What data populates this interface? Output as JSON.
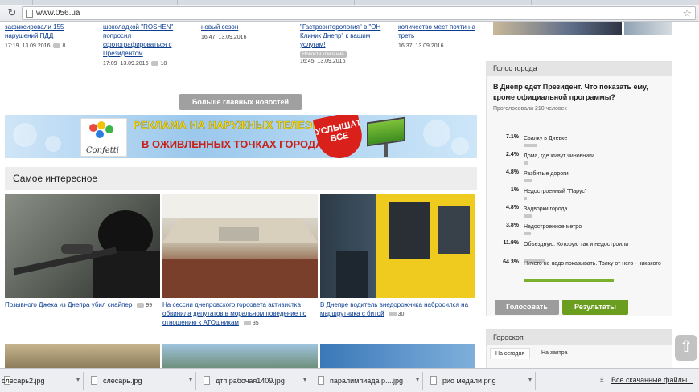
{
  "browser": {
    "url": "www.056.ua"
  },
  "top_news": [
    {
      "title": "зафиксировали 155 нарушений ПДД",
      "time": "17:19",
      "date": "13.09.2016",
      "comments": "8"
    },
    {
      "title": "шоколадкой \"ROSHEN\" попросил сфотографироваться с Президентом",
      "time": "17:09",
      "date": "13.09.2016",
      "comments": "18"
    },
    {
      "title": "новый сезон",
      "time": "16:47",
      "date": "13.09.2016",
      "comments": ""
    },
    {
      "title": "\"Гастроэнтерология\" в \"ОН Клиник Днепр\" к вашим услугам!",
      "tag": "Новости компаний",
      "time": "16:45",
      "date": "13.09.2016",
      "comments": ""
    },
    {
      "title": "количество мест почти на треть",
      "time": "16:37",
      "date": "13.09.2016",
      "comments": ""
    }
  ],
  "more_news_button": "Больше главных новостей",
  "banner": {
    "logo_text": "Confetti",
    "line1": "РЕКЛАМА НА НАРУЖНЫХ ТЕЛЕЭКРАНАХ",
    "line2": "В ОЖИВЛЕННЫХ ТОЧКАХ ГОРОДА",
    "badge": "УСЛЫШАТ ВСЕ"
  },
  "interesting": {
    "heading": "Самое интересное",
    "items": [
      {
        "title": "Позывного Джека из Днепра убил снайпер",
        "comments": "99"
      },
      {
        "title": "На сессии днепровского горсовета активистка обвинила депутатов в моральном поведение по отношению к АТОшникам",
        "comments": "35"
      },
      {
        "title": "В Днепре водитель внедорожника набросился на маршрутчика с битой",
        "comments": "30"
      }
    ]
  },
  "poll": {
    "header": "Голос города",
    "question": "В Днепр едет Президент. Что показать ему, кроме официальной программы?",
    "voted": "Проголосовали 210 человек",
    "options": [
      {
        "pct": "7.1%",
        "value": 7.1,
        "label": "Свалку в Диевке"
      },
      {
        "pct": "2.4%",
        "value": 2.4,
        "label": "Дома, где живут чиновники"
      },
      {
        "pct": "4.8%",
        "value": 4.8,
        "label": "Разбитые дороги"
      },
      {
        "pct": "1%",
        "value": 1,
        "label": "Недостроенный \"Парус\""
      },
      {
        "pct": "4.8%",
        "value": 4.8,
        "label": "Задворки города"
      },
      {
        "pct": "3.8%",
        "value": 3.8,
        "label": "Недостроенное метро"
      },
      {
        "pct": "11.9%",
        "value": 11.9,
        "label": "Объездную. Которую так и недостроили"
      },
      {
        "pct": "64.3%",
        "value": 64.3,
        "label": "Ничего не надо показывать. Толку от него - никакого"
      }
    ],
    "vote_button": "Голосовать",
    "results_button": "Результаты"
  },
  "horoscope": {
    "header": "Гороскоп",
    "tab_today": "На сегодня",
    "tab_tomorrow": "На завтра"
  },
  "downloads": {
    "files": [
      "слесарь2.jpg",
      "слесарь.jpg",
      "дтп рабочая1409.jpg",
      "паралимпиада р....jpg",
      "рио медали.png"
    ],
    "all_link": "Все скачанные файлы..."
  }
}
